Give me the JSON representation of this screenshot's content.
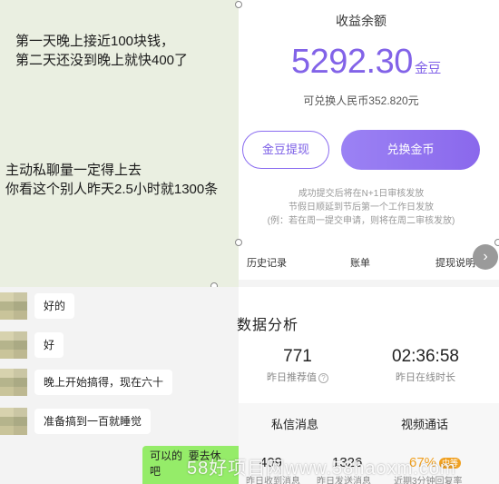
{
  "notes": {
    "line1": "第一天晚上接近100块钱，\n第二天还没到晚上就快400了",
    "line2": "主动私聊量一定得上去\n你看这个别人昨天2.5小时就1300条"
  },
  "earnings": {
    "title": "收益余额",
    "amount": "5292.30",
    "unit": "金豆",
    "rmb_text": "可兑换人民币352.820元",
    "withdraw_label": "金豆提现",
    "exchange_label": "兑换金币",
    "notice": "成功提交后将在N+1日审核发放\n节假日顺延到节后第一个工作日发放\n(例：若在周一提交申请，则将在周二审核发放)"
  },
  "menu": {
    "items": [
      "历史记录",
      "账单",
      "提现说明"
    ],
    "next_icon": "chevron-right-icon"
  },
  "chat": {
    "messages": [
      "好的",
      "好",
      "晚上开始搞得，现在六十",
      "准备搞到一百就睡觉"
    ],
    "my_message": "可以的  要去休\n吧"
  },
  "analysis": {
    "title": "数据分析",
    "recommend_value": "771",
    "recommend_label": "昨日推荐值",
    "online_value": "02:36:58",
    "online_label": "昨日在线时长",
    "tab_messages": "私信消息",
    "tab_video": "视频通话",
    "received_value": "409",
    "received_label": "昨日收到消息",
    "sent_value": "1326",
    "sent_label": "昨日发送消息",
    "reply_rate": "67%",
    "reply_tag": "中等",
    "reply_label": "近期3分钟回复率"
  },
  "watermark": "58好项目网www.58haoxm.com",
  "colors": {
    "accent": "#8263e8",
    "note_bg": "#eaefe1",
    "wechat_green": "#95ec69",
    "warning": "#f0a020"
  }
}
